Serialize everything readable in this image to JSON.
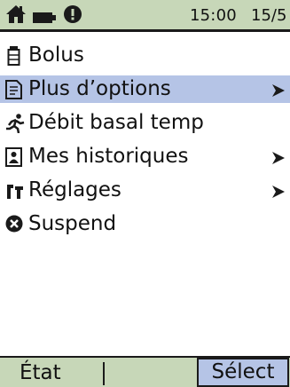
{
  "status_bar": {
    "time": "15:00",
    "date": "15/5",
    "icons": [
      "home-icon",
      "battery-icon",
      "alert-icon"
    ]
  },
  "menu": {
    "items": [
      {
        "label": "Bolus",
        "icon": "syringe-icon",
        "has_submenu": false,
        "selected": false
      },
      {
        "label": "Plus d’options",
        "icon": "document-icon",
        "has_submenu": true,
        "selected": true
      },
      {
        "label": "Débit basal temp",
        "icon": "running-person-icon",
        "has_submenu": false,
        "selected": false
      },
      {
        "label": "Mes historiques",
        "icon": "history-icon",
        "has_submenu": true,
        "selected": false
      },
      {
        "label": "Réglages",
        "icon": "settings-icon",
        "has_submenu": true,
        "selected": false
      },
      {
        "label": "Suspend",
        "icon": "suspend-icon",
        "has_submenu": false,
        "selected": false
      }
    ]
  },
  "softkeys": {
    "left_label": "État",
    "right_label": "Sélect"
  },
  "colors": {
    "bar_background": "#c7d7b8",
    "selection_highlight": "#b5c4e6",
    "text": "#111111"
  }
}
